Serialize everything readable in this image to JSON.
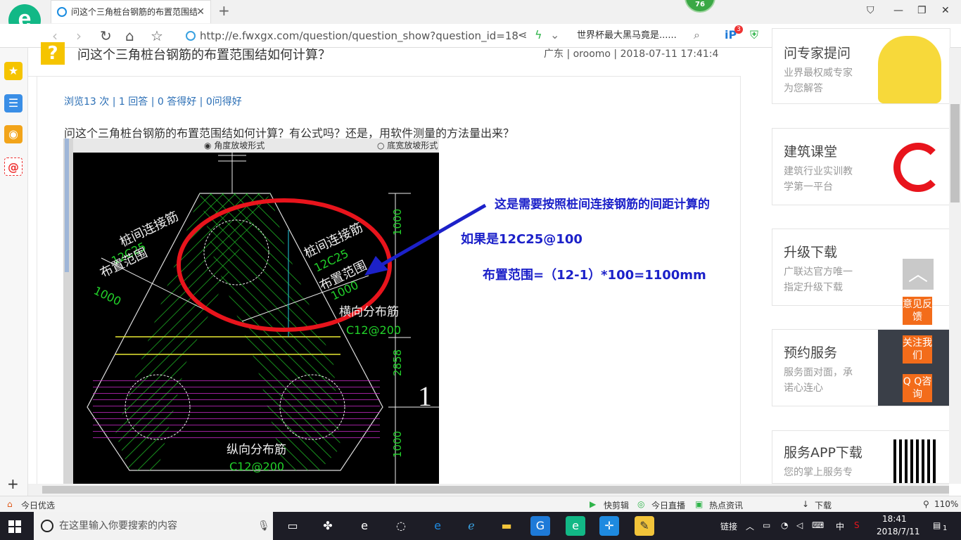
{
  "browser": {
    "tab_title": "问这个三角桩台钢筋的布置范围结",
    "tab_close": "✕",
    "new_tab": "+",
    "badge": "76",
    "url": "http://e.fwxgx.com/question/question_show?question_id=18",
    "search_text": "世界杯最大黑马竟是......",
    "tool_badge": "3"
  },
  "question": {
    "title": "问这个三角桩台钢筋的布置范围结如何计算？",
    "meta": "广东 | oroomo | 2018-07-11 17:41:4",
    "stats": "浏览13 次 | 1 回答 | 0 答得好 | 0问得好",
    "body": "问这个三角桩台钢筋的布置范围结如何计算？有公式吗？还是，用软件测量的方法量出来？"
  },
  "cad": {
    "opt1": "角度放坡形式",
    "opt2": "底宽放坡形式",
    "label_left_1": "桩间连接筋",
    "label_left_2": "12C25",
    "label_left_3": "布置范围",
    "label_left_4": "1000",
    "label_right_1": "桩间连接筋",
    "label_right_2": "12C25",
    "label_right_3": "布置范围",
    "label_right_4": "1000",
    "horiz_label": "横向分布筋",
    "horiz_spec": "C12@200",
    "vert_label": "纵向分布筋",
    "vert_spec": "C12@200",
    "dim_top": "1000",
    "dim_mid": "2858",
    "dim_bot": "1000",
    "big_one": "1"
  },
  "annotation": {
    "line1": "这是需要按照桩间连接钢筋的间距计算的",
    "line2": "如果是12C25@100",
    "line3": "布置范围=（12-1）*100=1100mm"
  },
  "right_cards": [
    {
      "title": "问专家提问",
      "sub1": "业界最权威专家",
      "sub2": "为您解答"
    },
    {
      "title": "建筑课堂",
      "sub1": "建筑行业实训教",
      "sub2": "学第一平台"
    },
    {
      "title": "升级下载",
      "sub1": "广联达官方唯一",
      "sub2": "指定升级下载"
    },
    {
      "title": "预约服务",
      "sub1": "服务面对面，承",
      "sub2": "诺心连心"
    },
    {
      "title": "服务APP下载",
      "sub1": "您的掌上服务专",
      "sub2": ""
    }
  ],
  "float_buttons": {
    "feedback": "意见反馈",
    "follow": "关注我们",
    "qq": "Q Q咨询"
  },
  "statusbar": {
    "left": "今日优选",
    "items": [
      "快剪辑",
      "今日直播",
      "热点资讯",
      "下载"
    ],
    "zoom": "110%"
  },
  "taskbar": {
    "search_placeholder": "在这里输入你要搜索的内容",
    "tray_link": "链接",
    "ime": "中",
    "time": "18:41",
    "date": "2018/7/11",
    "notif": "1"
  },
  "colors": {
    "accent_green": "#12b886",
    "annotation_blue": "#1c21c9",
    "float_orange": "#f36c1a",
    "link_blue": "#2a6eb5"
  }
}
